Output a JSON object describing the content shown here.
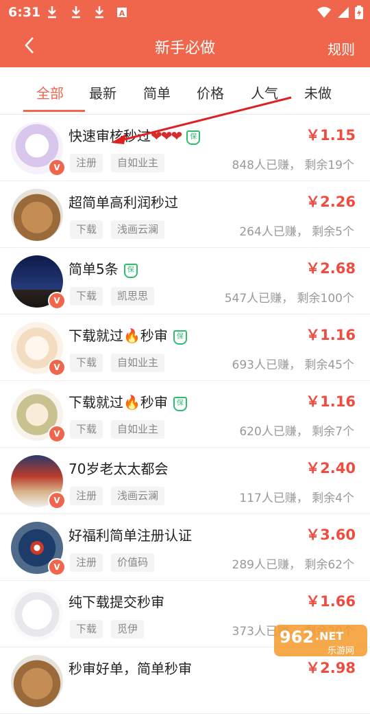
{
  "status_bar": {
    "time": "6:31",
    "icons": [
      "download-icon",
      "download-icon",
      "download-icon",
      "a-icon",
      "wifi-icon",
      "signal-icon",
      "battery-icon"
    ]
  },
  "header": {
    "title": "新手必做",
    "rules_label": "规则",
    "accent": "#f0664c"
  },
  "tabs": [
    {
      "label": "全部",
      "active": true
    },
    {
      "label": "最新",
      "active": false
    },
    {
      "label": "简单",
      "active": false
    },
    {
      "label": "价格",
      "active": false
    },
    {
      "label": "人气",
      "active": false
    },
    {
      "label": "未做",
      "active": false
    }
  ],
  "tasks": [
    {
      "title": "快速审核秒过",
      "badge_shield": true,
      "hearts": "❤❤❤",
      "price": "￥1.15",
      "tag1": "注册",
      "tag2": "自如业主",
      "stats": "848人已赚， 剩余19个"
    },
    {
      "title": "超简单高利润秒过",
      "badge_shield": false,
      "price": "￥2.26",
      "tag1": "下载",
      "tag2": "浅画云澜",
      "stats": "264人已赚， 剩余5个"
    },
    {
      "title": "简单5条",
      "badge_shield": true,
      "price": "￥2.68",
      "tag1": "下载",
      "tag2": "凯思思",
      "stats": "547人已赚， 剩余100个"
    },
    {
      "title_a": "下载就过",
      "title_b": "秒审",
      "fire": "🔥",
      "badge_shield": true,
      "price": "￥1.16",
      "tag1": "下载",
      "tag2": "自如业主",
      "stats": "693人已赚， 剩余45个"
    },
    {
      "title_a": "下载就过",
      "title_b": "秒审",
      "fire": "🔥",
      "badge_shield": true,
      "price": "￥1.16",
      "tag1": "下载",
      "tag2": "自如业主",
      "stats": "620人已赚， 剩余7个"
    },
    {
      "title": "70岁老太太都会",
      "badge_shield": false,
      "price": "￥2.40",
      "tag1": "注册",
      "tag2": "浅画云澜",
      "stats": "117人已赚， 剩余4个"
    },
    {
      "title": "好福利简单注册认证",
      "badge_shield": false,
      "price": "￥3.60",
      "tag1": "注册",
      "tag2": "价值码",
      "stats": "289人已赚， 剩余62个"
    },
    {
      "title": "纯下载提交秒审",
      "badge_shield": false,
      "price": "￥1.66",
      "tag1": "下载",
      "tag2": "觅伊",
      "stats": "373人已赚， 剩余20个"
    },
    {
      "title": "秒审好单，简单秒审",
      "badge_shield": false,
      "price": "￥2.98"
    }
  ],
  "badge_letter": "V",
  "shield_glyph": "保",
  "watermark": {
    "text_a": "962",
    "text_b": ".NET",
    "text_c": "乐游网"
  }
}
